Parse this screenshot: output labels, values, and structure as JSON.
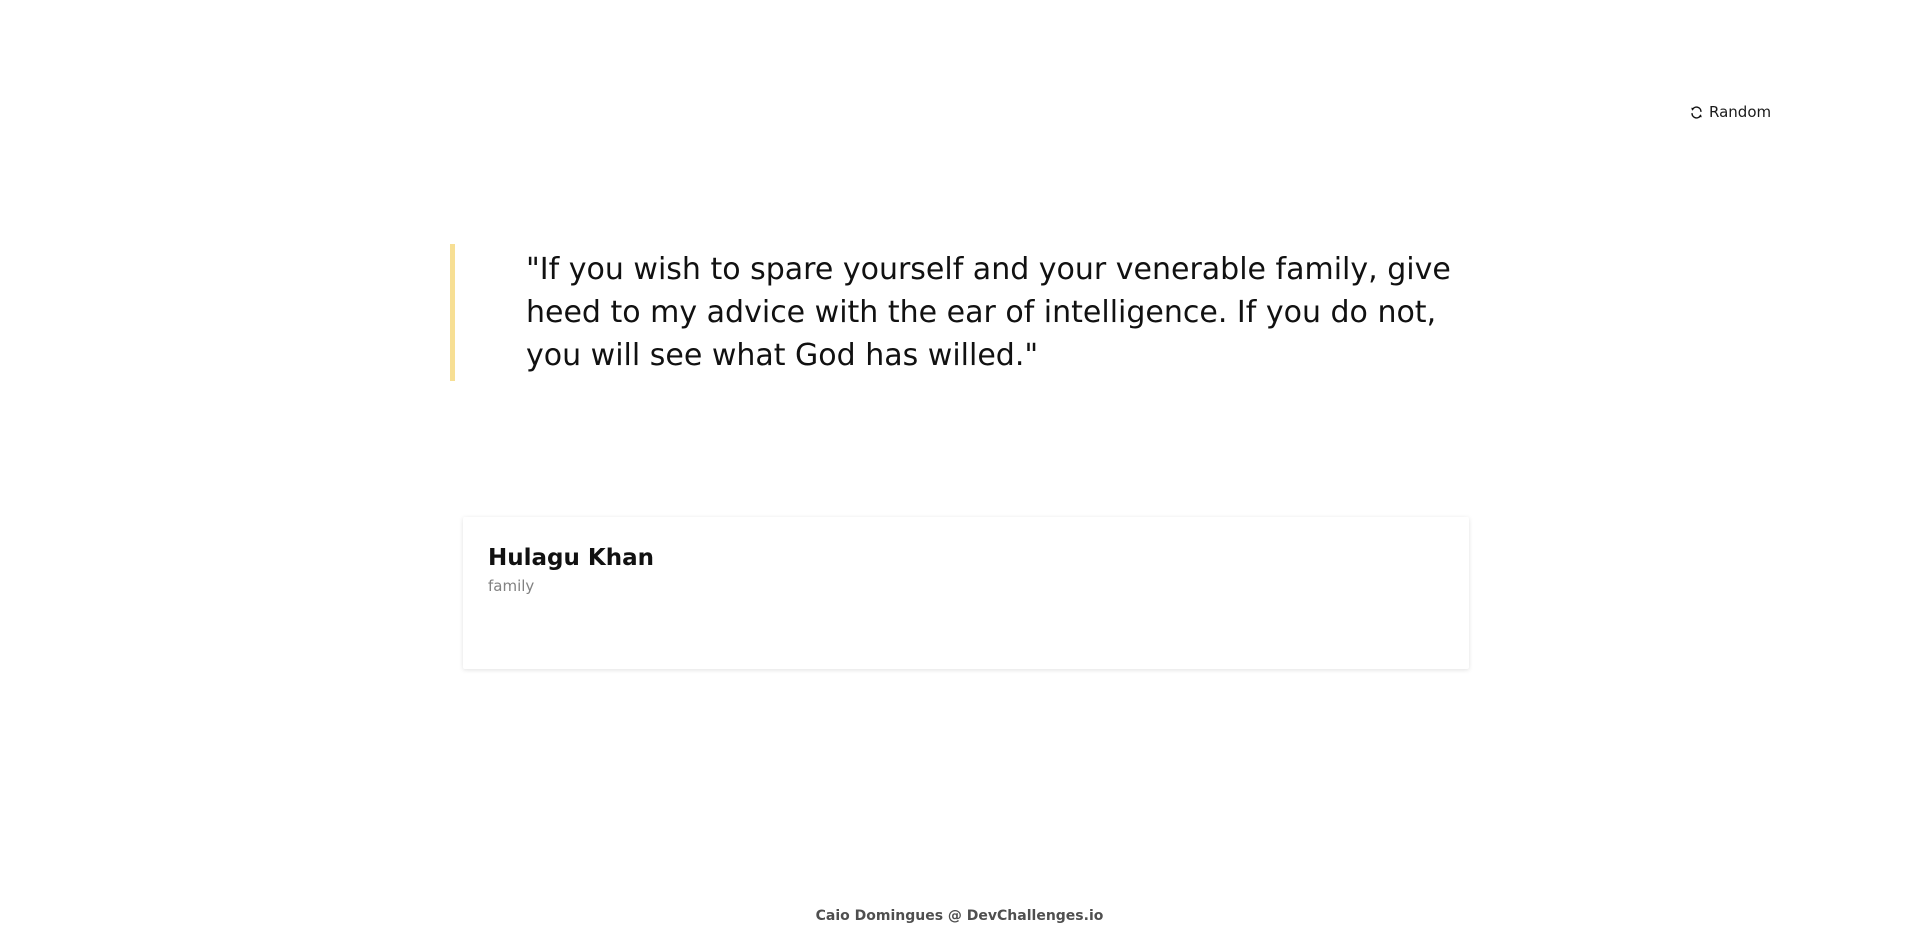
{
  "header": {
    "random_label": "Random",
    "random_icon": "refresh-icon"
  },
  "quote": {
    "text": "\"If you wish to spare yourself and your venerable family, give heed to my advice with the ear of intelligence. If you do not, you will see what God has willed.\"",
    "accent_color": "#f7df94"
  },
  "author": {
    "name": "Hulagu Khan",
    "genre": "family"
  },
  "footer": {
    "credit": "Caio Domingues @ DevChallenges.io"
  }
}
